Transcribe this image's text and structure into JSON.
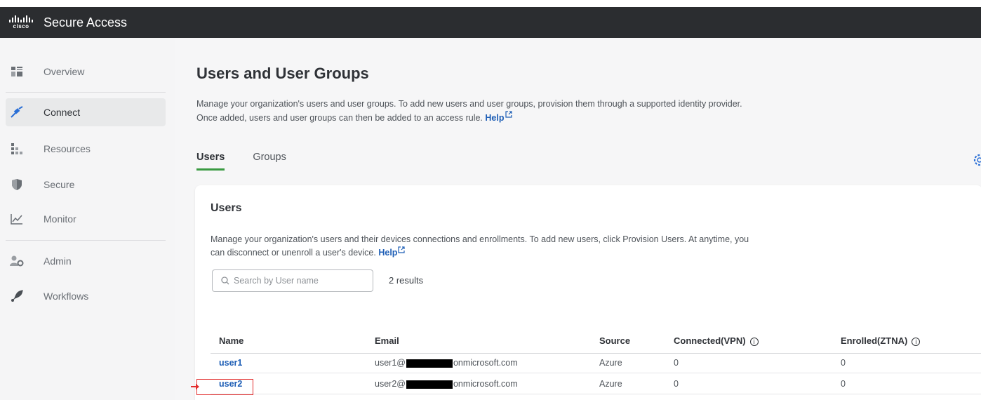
{
  "app": {
    "logo_text": "cisco",
    "title": "Secure Access"
  },
  "sidebar": {
    "items": [
      {
        "label": "Overview",
        "icon": "overview-icon"
      },
      {
        "label": "Connect",
        "icon": "connect-icon",
        "active": true
      },
      {
        "label": "Resources",
        "icon": "resources-icon"
      },
      {
        "label": "Secure",
        "icon": "shield-icon"
      },
      {
        "label": "Monitor",
        "icon": "chart-icon"
      },
      {
        "label": "Admin",
        "icon": "admin-icon"
      },
      {
        "label": "Workflows",
        "icon": "workflows-icon"
      }
    ]
  },
  "page": {
    "title": "Users and User Groups",
    "desc_line1": "Manage your organization's users and user groups. To add new users and user groups, provision them through a supported identity provider.",
    "desc_line2": "Once added, users and user groups can then be added to an access rule.",
    "help": "Help"
  },
  "tabs": [
    {
      "label": "Users",
      "active": true
    },
    {
      "label": "Groups"
    }
  ],
  "card": {
    "title": "Users",
    "desc_line1": "Manage your organization's users and their devices connections and enrollments. To add new users, click Provision Users. At anytime, you",
    "desc_line2": "can disconnect or unenroll a user's device.",
    "help": "Help",
    "search_placeholder": "Search by User name",
    "results": "2 results"
  },
  "table": {
    "columns": [
      "Name",
      "Email",
      "Source",
      "Connected(VPN)",
      "Enrolled(ZTNA)"
    ],
    "info_glyph": "i",
    "rows": [
      {
        "name": "user1",
        "email_prefix": "user1@",
        "email_suffix": "onmicrosoft.com",
        "source": "Azure",
        "connected": "0",
        "enrolled": "0"
      },
      {
        "name": "user2",
        "email_prefix": "user2@",
        "email_suffix": "onmicrosoft.com",
        "source": "Azure",
        "connected": "0",
        "enrolled": "0"
      }
    ]
  },
  "colors": {
    "accent": "#3a9a42",
    "link": "#1f5fb6",
    "highlight": "#e22d2d"
  }
}
